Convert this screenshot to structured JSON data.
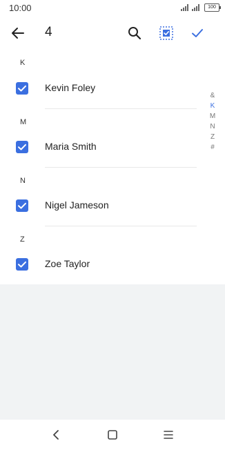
{
  "status_bar": {
    "time": "10:00",
    "battery": "100"
  },
  "app_bar": {
    "selected_count": "4",
    "icons": {
      "back": "arrow-left-icon",
      "search": "search-icon",
      "select_all": "select-all-icon",
      "done": "check-icon"
    }
  },
  "contacts": [
    {
      "section": "K",
      "name": "Kevin Foley",
      "checked": true
    },
    {
      "section": "M",
      "name": "Maria Smith",
      "checked": true
    },
    {
      "section": "N",
      "name": "Nigel Jameson",
      "checked": true
    },
    {
      "section": "Z",
      "name": "Zoe Taylor",
      "checked": true
    }
  ],
  "index_bar": {
    "letters": [
      "&",
      "K",
      "M",
      "N",
      "Z",
      "#"
    ],
    "active": "K"
  },
  "colors": {
    "accent": "#3b6fe0",
    "background": "#f1f3f4",
    "surface": "#ffffff"
  },
  "nav_bar": {
    "icons": [
      "back-triangle-icon",
      "home-square-icon",
      "menu-lines-icon"
    ]
  }
}
